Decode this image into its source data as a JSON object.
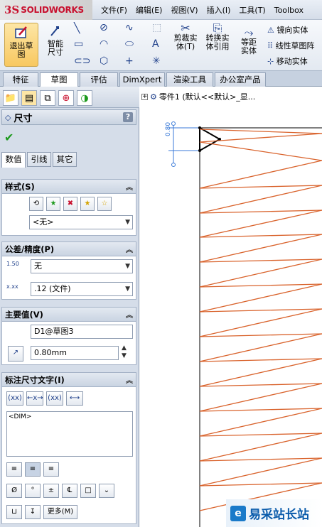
{
  "app": {
    "logo_prefix": "3S",
    "brand": "SOLIDWORKS"
  },
  "menu": [
    "文件(F)",
    "编辑(E)",
    "视图(V)",
    "插入(I)",
    "工具(T)",
    "Toolbox"
  ],
  "ribbon": {
    "exit_sketch": "退出草图",
    "smart_dim": "智能尺寸",
    "trim": "剪裁实体(T)",
    "convert": "转换实体引用",
    "offset": "等距实体",
    "mirror": "镜向实体",
    "linear_pattern": "线性草图阵",
    "move": "移动实体"
  },
  "tabs": [
    "特征",
    "草图",
    "评估",
    "DimXpert",
    "渲染工具",
    "办公室产品"
  ],
  "active_tab": "草图",
  "panel": {
    "title": "尺寸",
    "help": "?",
    "subtabs": [
      "数值",
      "引线",
      "其它"
    ],
    "style": {
      "header": "样式(S)",
      "selected": "<无>"
    },
    "tolerance": {
      "header": "公差/精度(P)",
      "tol_type": "无",
      "precision": ".12 (文件)",
      "tol_icon_text": "1.50",
      "prec_icon_text": "x.xx"
    },
    "primary": {
      "header": "主要值(V)",
      "name": "D1@草图3",
      "value": "0.80mm"
    },
    "dimtext": {
      "header": "标注尺寸文字(I)",
      "text": "<DIM>",
      "buttons": [
        "(xx)",
        "←x→",
        "(xx)"
      ],
      "more": "更多(M)"
    }
  },
  "canvas": {
    "tree_label": "零件1 (默认<<默认>_显...",
    "dimension_value": "0.80"
  },
  "watermark": {
    "logo": "e",
    "text": "易采站长站"
  },
  "colors": {
    "accent": "#c8102e",
    "spring": "#d9622b",
    "panel_bg": "#d5dde9"
  }
}
